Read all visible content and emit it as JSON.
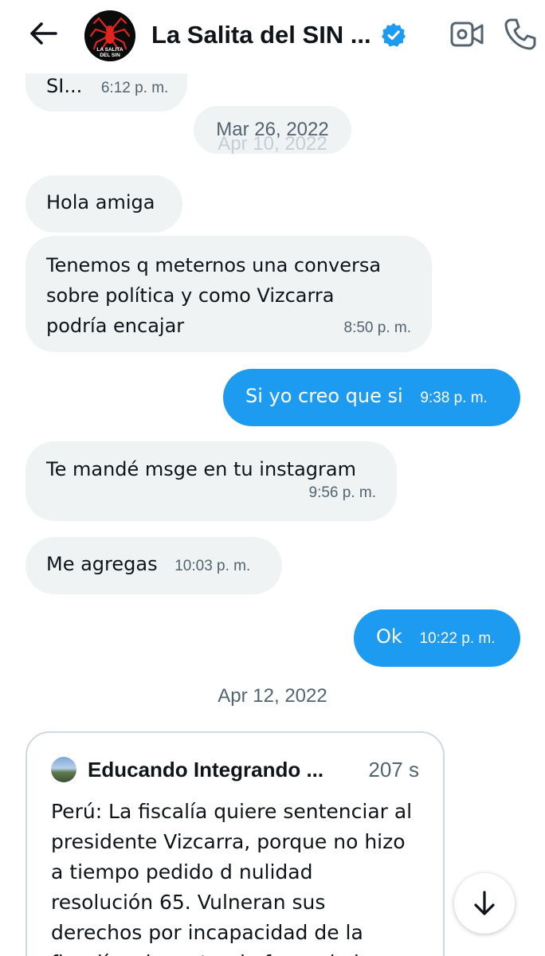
{
  "header": {
    "title": "La Salita del SIN ...",
    "avatar_text_line1": "LA SALITA",
    "avatar_text_line2": "DEL SIN",
    "accent": "#1d9bf0"
  },
  "messages": [
    {
      "id": "m0",
      "direction": "in",
      "text": "SI...",
      "time": "6:12 p. m."
    },
    {
      "id": "m1",
      "direction": "in",
      "text": "Hola amiga",
      "time": ""
    },
    {
      "id": "m2",
      "direction": "in",
      "lines": [
        "Tenemos q meternos una conversa",
        "sobre política y como Vizcarra",
        "podría encajar"
      ],
      "time": "8:50 p. m."
    },
    {
      "id": "m3",
      "direction": "out",
      "text": "Si yo creo que si",
      "time": "9:38 p. m."
    },
    {
      "id": "m4",
      "direction": "in",
      "text": "Te mandé msge en tu instagram",
      "time": "9:56 p. m."
    },
    {
      "id": "m5",
      "direction": "in",
      "text": "Me agregas",
      "time": "10:03 p. m."
    },
    {
      "id": "m6",
      "direction": "out",
      "text": "Ok",
      "time": "10:22 p. m."
    }
  ],
  "dates": {
    "sticky": "Mar 26, 2022",
    "sticky_ghost": "Apr 10, 2022",
    "divider": "Apr 12, 2022"
  },
  "tweet": {
    "author": "Educando Integrando ...",
    "age": "207 s",
    "lines": [
      "Perú: La fiscalía quiere sentenciar al",
      "presidente Vizcarra, porque no hizo",
      "a tiempo pedido d nulidad",
      "resolución 65. Vulneran sus",
      "derechos por incapacidad de la",
      "fiscalía q ha actuado fuera de ley..."
    ]
  },
  "icons": {
    "back": "arrow-left-icon",
    "verified": "verified-badge-icon",
    "video": "video-call-icon",
    "phone": "phone-icon",
    "scroll": "arrow-down-icon"
  }
}
